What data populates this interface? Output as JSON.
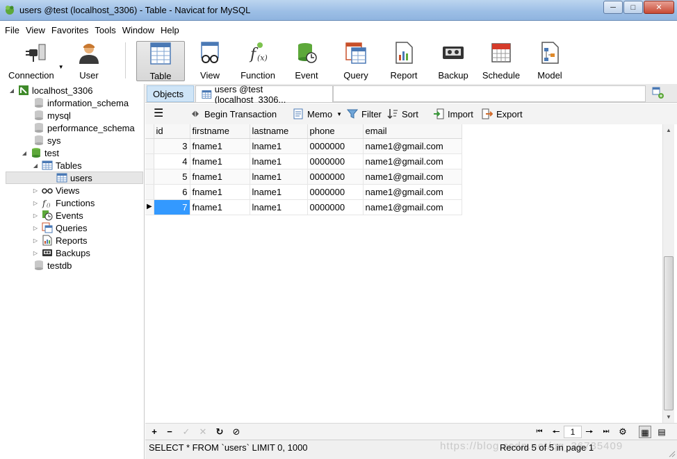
{
  "window": {
    "title": "users @test (localhost_3306) - Table - Navicat for MySQL",
    "minimize_icon": "minimize-icon",
    "maximize_icon": "maximize-icon",
    "close_icon": "close-icon"
  },
  "menu": [
    "File",
    "View",
    "Favorites",
    "Tools",
    "Window",
    "Help"
  ],
  "toolbar": {
    "connection": "Connection",
    "user": "User",
    "table": "Table",
    "view": "View",
    "function": "Function",
    "event": "Event",
    "query": "Query",
    "report": "Report",
    "backup": "Backup",
    "schedule": "Schedule",
    "model": "Model"
  },
  "tree": {
    "connection": "localhost_3306",
    "databases": [
      "information_schema",
      "mysql",
      "performance_schema",
      "sys",
      "test",
      "testdb"
    ],
    "test": {
      "tables": "Tables",
      "users": "users",
      "views": "Views",
      "functions": "Functions",
      "events": "Events",
      "queries": "Queries",
      "reports": "Reports",
      "backups": "Backups"
    }
  },
  "tabs": {
    "objects": "Objects",
    "users": "users @test (localhost_3306..."
  },
  "data_toolbar": {
    "begin_transaction": "Begin Transaction",
    "memo": "Memo",
    "filter": "Filter",
    "sort": "Sort",
    "import": "Import",
    "export": "Export"
  },
  "grid": {
    "columns": [
      "id",
      "firstname",
      "lastname",
      "phone",
      "email"
    ],
    "rows": [
      [
        "3",
        "fname1",
        "lname1",
        "0000000",
        "name1@gmail.com"
      ],
      [
        "4",
        "fname1",
        "lname1",
        "0000000",
        "name1@gmail.com"
      ],
      [
        "5",
        "fname1",
        "lname1",
        "0000000",
        "name1@gmail.com"
      ],
      [
        "6",
        "fname1",
        "lname1",
        "0000000",
        "name1@gmail.com"
      ],
      [
        "7",
        "fname1",
        "lname1",
        "0000000",
        "name1@gmail.com"
      ]
    ],
    "selected_row": 4
  },
  "nav": {
    "page": "1"
  },
  "status": {
    "sql": "SELECT * FROM `users` LIMIT 0, 1000",
    "record": "Record 5 of 5 in page 1",
    "watermark": "https://blog.csdn.net/qq_36735409"
  },
  "colors": {
    "selection": "#3399ff",
    "titlebar": "#9dbfe6",
    "objects_tab": "#cfe5f7"
  }
}
